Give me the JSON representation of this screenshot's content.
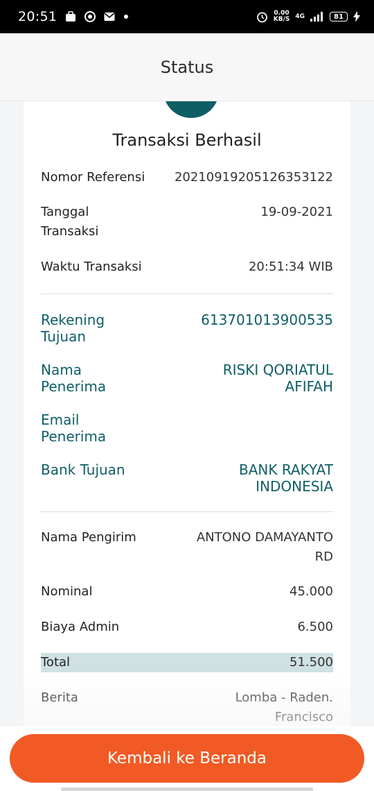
{
  "status_bar": {
    "time": "20:51",
    "speed_value": "0.00",
    "speed_unit": "KB/S",
    "network": "4G",
    "battery": "81"
  },
  "header": {
    "title": "Status"
  },
  "card": {
    "title": "Transaksi Berhasil",
    "reference": {
      "label": "Nomor Referensi",
      "value": "20210919205126353122"
    },
    "date": {
      "label_line1": "Tanggal",
      "label_line2": "Transaksi",
      "value": "19-09-2021"
    },
    "time": {
      "label": "Waktu Transaksi",
      "value": "20:51:34 WIB"
    },
    "account": {
      "label_line1": "Rekening",
      "label_line2": "Tujuan",
      "value": "613701013900535"
    },
    "recipient_name": {
      "label_line1": "Nama",
      "label_line2": "Penerima",
      "value_line1": "RISKI QORIATUL",
      "value_line2": "AFIFAH"
    },
    "recipient_email": {
      "label_line1": "Email",
      "label_line2": "Penerima",
      "value": ""
    },
    "bank": {
      "label": "Bank Tujuan",
      "value_line1": "BANK RAKYAT",
      "value_line2": "INDONESIA"
    },
    "sender": {
      "label": "Nama Pengirim",
      "value_line1": "ANTONO DAMAYANTO",
      "value_line2": "RD"
    },
    "nominal": {
      "label": "Nominal",
      "value": "45.000"
    },
    "admin_fee": {
      "label": "Biaya Admin",
      "value": "6.500"
    },
    "total": {
      "label": "Total",
      "value": "51.500"
    },
    "message": {
      "label": "Berita",
      "value_line1": "Lomba - Raden.",
      "value_line2": "Francisco"
    }
  },
  "footer": {
    "home_button": "Kembali ke Beranda"
  },
  "colors": {
    "accent": "#f15a24",
    "teal": "#0f5e67",
    "total_highlight": "#cfe1e3"
  }
}
